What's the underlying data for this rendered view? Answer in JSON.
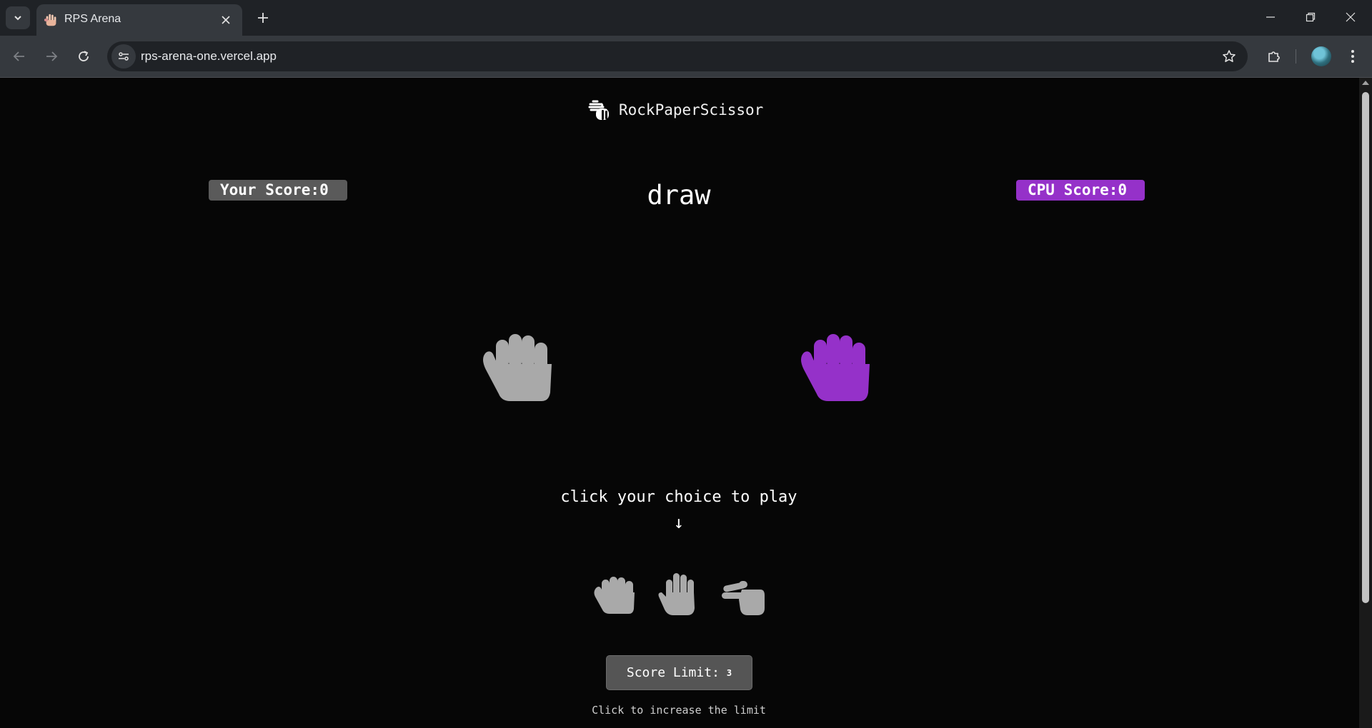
{
  "browser": {
    "tab_title": "RPS Arena",
    "url": "rps-arena-one.vercel.app",
    "icons": {
      "tab_search": "chevron-down-icon",
      "favicon": "hand-icon",
      "tab_close": "close-icon",
      "new_tab": "plus-icon",
      "back": "arrow-left-icon",
      "forward": "arrow-right-icon",
      "reload": "reload-icon",
      "site_info": "tune-icon",
      "bookmark": "star-icon",
      "extensions": "puzzle-icon",
      "menu": "kebab-menu-icon"
    }
  },
  "app": {
    "logo_text": "RockPaperScissor",
    "your_score_label": "Your Score:0",
    "cpu_score_label": "CPU Score:0",
    "result": "draw",
    "player_choice": "rock",
    "cpu_choice": "rock",
    "instruction": "click your choice to play",
    "arrow": "↓",
    "choices": [
      "rock",
      "paper",
      "scissors"
    ],
    "score_limit_label": "Score Limit:",
    "score_limit_value": "3",
    "limit_hint": "Click to increase the limit",
    "colors": {
      "player": "#a9a9a9",
      "cpu": "#9531c9",
      "player_badge": "#5a5a5a",
      "cpu_badge": "#9531c9",
      "background": "#060606"
    }
  }
}
